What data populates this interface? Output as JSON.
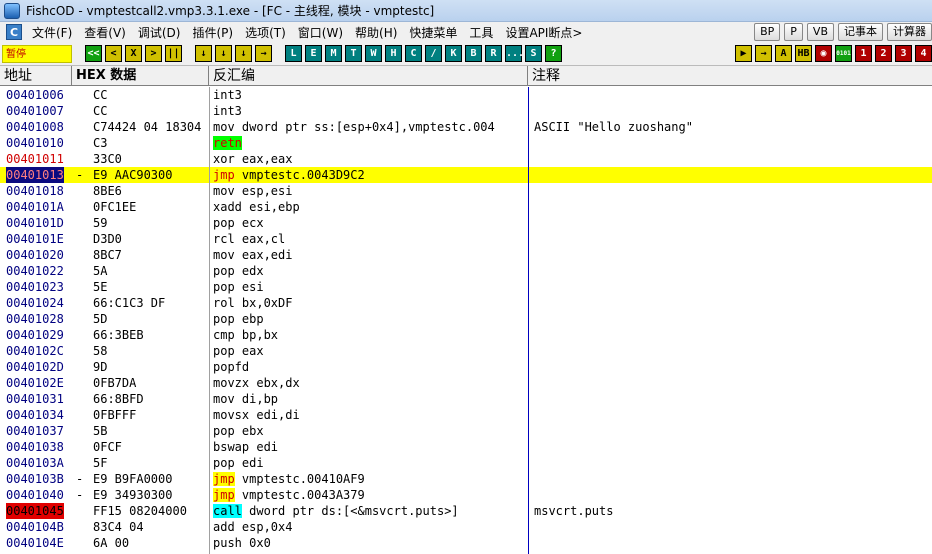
{
  "window": {
    "title": "FishcOD - vmptestcall2.vmp3.3.1.exe - [FC - 主线程, 模块 - vmptestc]"
  },
  "menu": {
    "icon_letter": "C",
    "items": [
      "文件(F)",
      "查看(V)",
      "调试(D)",
      "插件(P)",
      "选项(T)",
      "窗口(W)",
      "帮助(H)",
      "快捷菜单",
      "工具",
      "设置API断点>"
    ],
    "right_buttons": [
      "BP",
      "P",
      "VB",
      "记事本",
      "计算器"
    ]
  },
  "toolbar": {
    "status_label": "暂停",
    "group1": [
      "<<",
      "<",
      "X",
      ">",
      "||",
      "↓",
      "↓",
      "↓",
      "→"
    ],
    "group2": [
      "L",
      "E",
      "M",
      "T",
      "W",
      "H",
      "C",
      "/",
      "K",
      "B",
      "R",
      "...",
      "S",
      "?"
    ],
    "group3": [
      "▶",
      "→",
      "A",
      "HB",
      "◉",
      "0101",
      "1",
      "2",
      "3",
      "4"
    ]
  },
  "columns": {
    "address": "地址",
    "hex": "HEX 数据",
    "disasm": "反汇编",
    "comment": "注释"
  },
  "rows": [
    {
      "addr": "00401006",
      "mark": "",
      "hex": "CC",
      "asm_kw": "",
      "asm": "int3",
      "cmt": "",
      "style": ""
    },
    {
      "addr": "00401007",
      "mark": "",
      "hex": "CC",
      "asm_kw": "",
      "asm": "int3",
      "cmt": "",
      "style": ""
    },
    {
      "addr": "00401008",
      "mark": "",
      "hex": "C74424 04 18304",
      "asm_kw": "",
      "asm": "mov dword ptr ss:[esp+0x4],vmptestc.004",
      "cmt": "ASCII \"Hello zuoshang\"",
      "style": ""
    },
    {
      "addr": "00401010",
      "mark": "",
      "hex": "C3",
      "asm_kw": "retn",
      "asm": "",
      "cmt": "",
      "style": "retn"
    },
    {
      "addr": "00401011",
      "mark": "",
      "hex": "33C0",
      "asm_kw": "",
      "asm": "xor eax,eax",
      "cmt": "",
      "style": "red"
    },
    {
      "addr": "00401013",
      "mark": "-",
      "hex": "E9 AAC90300",
      "asm_kw": "jmp",
      "asm": " vmptestc.0043D9C2",
      "cmt": "",
      "style": "sel"
    },
    {
      "addr": "00401018",
      "mark": "",
      "hex": "8BE6",
      "asm_kw": "",
      "asm": "mov esp,esi",
      "cmt": "",
      "style": ""
    },
    {
      "addr": "0040101A",
      "mark": "",
      "hex": "0FC1EE",
      "asm_kw": "",
      "asm": "xadd esi,ebp",
      "cmt": "",
      "style": ""
    },
    {
      "addr": "0040101D",
      "mark": "",
      "hex": "59",
      "asm_kw": "",
      "asm": "pop ecx",
      "cmt": "",
      "style": ""
    },
    {
      "addr": "0040101E",
      "mark": "",
      "hex": "D3D0",
      "asm_kw": "",
      "asm": "rcl eax,cl",
      "cmt": "",
      "style": ""
    },
    {
      "addr": "00401020",
      "mark": "",
      "hex": "8BC7",
      "asm_kw": "",
      "asm": "mov eax,edi",
      "cmt": "",
      "style": ""
    },
    {
      "addr": "00401022",
      "mark": "",
      "hex": "5A",
      "asm_kw": "",
      "asm": "pop edx",
      "cmt": "",
      "style": ""
    },
    {
      "addr": "00401023",
      "mark": "",
      "hex": "5E",
      "asm_kw": "",
      "asm": "pop esi",
      "cmt": "",
      "style": ""
    },
    {
      "addr": "00401024",
      "mark": "",
      "hex": "66:C1C3 DF",
      "asm_kw": "",
      "asm": "rol bx,0xDF",
      "cmt": "",
      "style": ""
    },
    {
      "addr": "00401028",
      "mark": "",
      "hex": "5D",
      "asm_kw": "",
      "asm": "pop ebp",
      "cmt": "",
      "style": ""
    },
    {
      "addr": "00401029",
      "mark": "",
      "hex": "66:3BEB",
      "asm_kw": "",
      "asm": "cmp bp,bx",
      "cmt": "",
      "style": ""
    },
    {
      "addr": "0040102C",
      "mark": "",
      "hex": "58",
      "asm_kw": "",
      "asm": "pop eax",
      "cmt": "",
      "style": ""
    },
    {
      "addr": "0040102D",
      "mark": "",
      "hex": "9D",
      "asm_kw": "",
      "asm": "popfd",
      "cmt": "",
      "style": ""
    },
    {
      "addr": "0040102E",
      "mark": "",
      "hex": "0FB7DA",
      "asm_kw": "",
      "asm": "movzx ebx,dx",
      "cmt": "",
      "style": ""
    },
    {
      "addr": "00401031",
      "mark": "",
      "hex": "66:8BFD",
      "asm_kw": "",
      "asm": "mov di,bp",
      "cmt": "",
      "style": ""
    },
    {
      "addr": "00401034",
      "mark": "",
      "hex": "0FBFFF",
      "asm_kw": "",
      "asm": "movsx edi,di",
      "cmt": "",
      "style": ""
    },
    {
      "addr": "00401037",
      "mark": "",
      "hex": "5B",
      "asm_kw": "",
      "asm": "pop ebx",
      "cmt": "",
      "style": ""
    },
    {
      "addr": "00401038",
      "mark": "",
      "hex": "0FCF",
      "asm_kw": "",
      "asm": "bswap edi",
      "cmt": "",
      "style": ""
    },
    {
      "addr": "0040103A",
      "mark": "",
      "hex": "5F",
      "asm_kw": "",
      "asm": "pop edi",
      "cmt": "",
      "style": ""
    },
    {
      "addr": "0040103B",
      "mark": "-",
      "hex": "E9 B9FA0000",
      "asm_kw": "jmp",
      "asm": " vmptestc.00410AF9",
      "cmt": "",
      "style": "jmp"
    },
    {
      "addr": "00401040",
      "mark": "-",
      "hex": "E9 34930300",
      "asm_kw": "jmp",
      "asm": " vmptestc.0043A379",
      "cmt": "",
      "style": "jmp"
    },
    {
      "addr": "00401045",
      "mark": "",
      "hex": "FF15 08204000",
      "asm_kw": "call",
      "asm": " dword ptr ds:[<&msvcrt.puts>]",
      "cmt": "msvcrt.puts",
      "style": "call"
    },
    {
      "addr": "0040104B",
      "mark": "",
      "hex": "83C4 04",
      "asm_kw": "",
      "asm": "add esp,0x4",
      "cmt": "",
      "style": ""
    },
    {
      "addr": "0040104E",
      "mark": "",
      "hex": "6A 00",
      "asm_kw": "",
      "asm": "push 0x0",
      "cmt": "",
      "style": ""
    }
  ]
}
